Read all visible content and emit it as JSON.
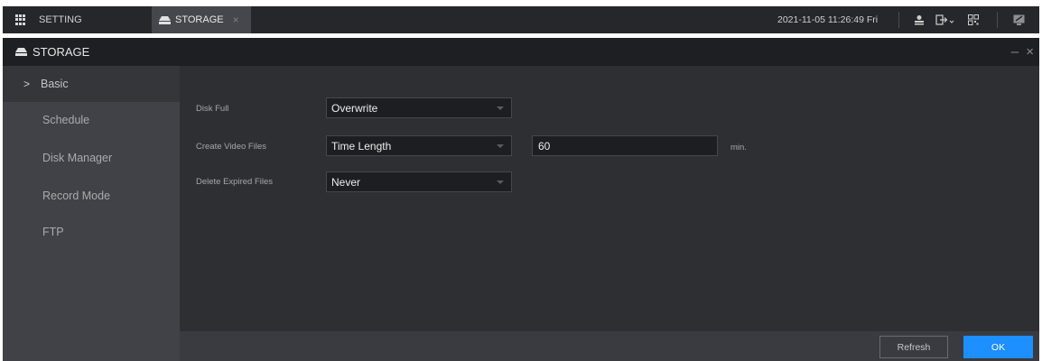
{
  "topbar": {
    "setting_tab": "SETTING",
    "storage_tab": "STORAGE",
    "close_glyph": "×",
    "datetime": "2021-11-05 11:26:49 Fri",
    "icons": [
      "grid-menu-icon",
      "drive-icon",
      "user-icon",
      "logout-icon",
      "qr-code-icon",
      "minimize-screen-icon"
    ]
  },
  "panel": {
    "title": "STORAGE",
    "window_controls": "– ×"
  },
  "sidebar": {
    "items": [
      {
        "label": "Basic",
        "active": true
      },
      {
        "label": "Schedule"
      },
      {
        "label": "Disk Manager"
      },
      {
        "label": "Record Mode"
      },
      {
        "label": "FTP"
      }
    ]
  },
  "form": {
    "disk_full": {
      "label": "Disk Full",
      "value": "Overwrite"
    },
    "create_video_files": {
      "label": "Create Video Files",
      "value": "Time Length",
      "length": "60",
      "unit": "min."
    },
    "delete_expired_files": {
      "label": "Delete Expired Files",
      "value": "Never"
    }
  },
  "footer": {
    "refresh_label": "Refresh",
    "ok_label": "OK"
  },
  "colors": {
    "accent": "#1e8fff",
    "panel_bg": "#2e2f33",
    "sidebar_bg": "#414247",
    "topbar_bg": "#26272a"
  }
}
